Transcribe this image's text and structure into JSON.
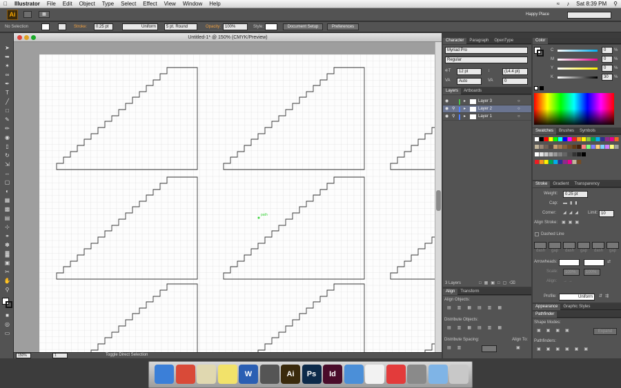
{
  "menubar": {
    "app": "Illustrator",
    "items": [
      "File",
      "Edit",
      "Object",
      "Type",
      "Select",
      "Effect",
      "View",
      "Window",
      "Help"
    ],
    "clock": "Sat 8:39 PM",
    "workspace": "Happy Place"
  },
  "appbar": {
    "logo": "Ai"
  },
  "control": {
    "selection": "No Selection",
    "stroke_label": "Stroke:",
    "stroke_weight": "0.25 pt",
    "profile": "Uniform",
    "brush": "5 pt. Round",
    "opacity_label": "Opacity:",
    "opacity": "100%",
    "style_label": "Style:",
    "doc_setup": "Document Setup",
    "preferences": "Preferences"
  },
  "document": {
    "title": "Untitled-1* @ 150% (CMYK/Preview)",
    "zoom": "150%",
    "page": "1",
    "status": "Toggle Direct Selection",
    "cursor_hint": "path"
  },
  "character": {
    "tabs": [
      "Character",
      "Paragraph",
      "OpenType"
    ],
    "font": "Myriad Pro",
    "style": "Regular",
    "size": "12 pt",
    "leading": "(14.4 pt)",
    "kerning": "Auto",
    "tracking": "0"
  },
  "layers": {
    "tabs": [
      "Layers",
      "Artboards"
    ],
    "items": [
      {
        "name": "Layer 3",
        "color": "#4fbf4f"
      },
      {
        "name": "Layer 2",
        "color": "#4f7fff"
      },
      {
        "name": "Layer 1",
        "color": "#4f7fff"
      }
    ],
    "count": "3 Layers"
  },
  "align": {
    "tabs": [
      "Align",
      "Transform"
    ],
    "align_objects": "Align Objects:",
    "distribute_objects": "Distribute Objects:",
    "distribute_spacing": "Distribute Spacing:",
    "align_to": "Align To:"
  },
  "color": {
    "title": "Color",
    "channels": [
      {
        "name": "C",
        "value": "0",
        "unit": "%"
      },
      {
        "name": "M",
        "value": "0",
        "unit": "%"
      },
      {
        "name": "Y",
        "value": "0",
        "unit": "%"
      },
      {
        "name": "K",
        "value": "30",
        "unit": "%"
      }
    ]
  },
  "swatches": {
    "tabs": [
      "Swatches",
      "Brushes",
      "Symbols"
    ]
  },
  "stroke": {
    "tabs": [
      "Stroke",
      "Gradient",
      "Transparency"
    ],
    "weight_label": "Weight:",
    "weight": "0.25 pt",
    "cap_label": "Cap:",
    "corner_label": "Corner:",
    "limit_label": "Limit:",
    "limit": "10",
    "align_label": "Align Stroke:",
    "dashed": "Dashed Line",
    "dash_labels": [
      "dash",
      "gap",
      "dash",
      "gap",
      "dash",
      "gap"
    ],
    "arrowheads": "Arrowheads:",
    "scale": "Scale:",
    "scale_values": [
      "100%",
      "100%"
    ],
    "align2": "Align:",
    "profile_label": "Profile:",
    "profile": "Uniform"
  },
  "appearance": {
    "tabs": [
      "Appearance",
      "Graphic Styles"
    ]
  },
  "pathfinder": {
    "title": "Pathfinder",
    "shape_modes": "Shape Modes:",
    "expand": "Expand",
    "pathfinders": "Pathfinders:"
  },
  "dock": {
    "items": [
      {
        "name": "finder-icon",
        "label": "",
        "color": "#3b7fd8"
      },
      {
        "name": "chrome-icon",
        "label": "",
        "color": "#d94a38"
      },
      {
        "name": "preview-icon",
        "label": "",
        "color": "#e0d8b0"
      },
      {
        "name": "stickies-icon",
        "label": "",
        "color": "#f2e26a"
      },
      {
        "name": "word-icon",
        "label": "W",
        "color": "#2b5fb3"
      },
      {
        "name": "photo-booth-icon",
        "label": "",
        "color": "#555555"
      },
      {
        "name": "illustrator-icon",
        "label": "Ai",
        "color": "#3a2a0c"
      },
      {
        "name": "photoshop-icon",
        "label": "Ps",
        "color": "#0c2a4a"
      },
      {
        "name": "indesign-icon",
        "label": "Id",
        "color": "#4a0c2a"
      },
      {
        "name": "keynote-icon",
        "label": "",
        "color": "#4b8fd8"
      },
      {
        "name": "textedit-icon",
        "label": "",
        "color": "#f2f2f2"
      },
      {
        "name": "presenter-icon",
        "label": "",
        "color": "#e33b3b"
      },
      {
        "name": "utilities-icon",
        "label": "",
        "color": "#8a8a8a"
      },
      {
        "name": "downloads-icon",
        "label": "",
        "color": "#7fb4e6"
      },
      {
        "name": "trash-icon",
        "label": "",
        "color": "#c8c8c8"
      }
    ]
  }
}
